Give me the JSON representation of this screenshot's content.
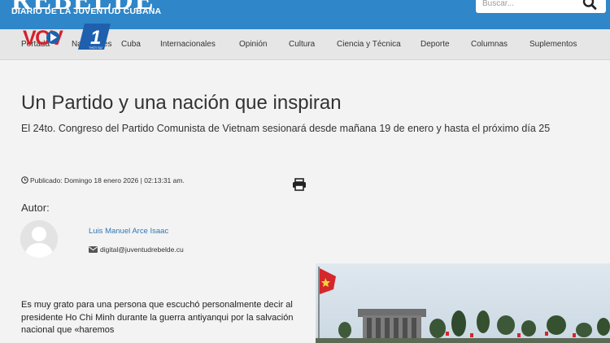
{
  "header": {
    "brand": "REBELDE",
    "tagline": "DIARIO DE LA JUVENTUD CUBANA",
    "search_placeholder": "Buscar...",
    "search_icon": "search-icon"
  },
  "nav": {
    "items": [
      {
        "label": "Portada"
      },
      {
        "label": "Nacionales"
      },
      {
        "label": "Cuba"
      },
      {
        "label": "Internacionales"
      },
      {
        "label": "Opinión"
      },
      {
        "label": "Cultura"
      },
      {
        "label": "Ciencia y Técnica"
      },
      {
        "label": "Deporte"
      },
      {
        "label": "Columnas"
      },
      {
        "label": "Suplementos"
      }
    ],
    "overlay_logo": {
      "text_vov": "VOV",
      "text_num": "1",
      "text_small": "THỜI SỰ"
    }
  },
  "article": {
    "title": "Un Partido y una nación que inspiran",
    "subtitle": "El 24to. Congreso del Partido Comunista de Vietnam sesionará desde mañana 19 de enero y hasta el próximo día 25",
    "published": "Publicado: Domingo 18 enero 2026 | 02:13:31 am.",
    "author_heading": "Autor:",
    "author_name": "Luis Manuel Arce Isaac",
    "author_email": "digital@juventudrebelde.cu",
    "body": "Es muy grato para una persona que escuchó personalmente decir al presidente Ho Chi Minh durante la guerra antiyanqui por la salvación nacional que «haremos"
  },
  "colors": {
    "header_blue": "#2f86c8",
    "link_blue": "#3077b5",
    "nav_bg": "#e6e6e6",
    "page_bg": "#f3f3f3"
  }
}
